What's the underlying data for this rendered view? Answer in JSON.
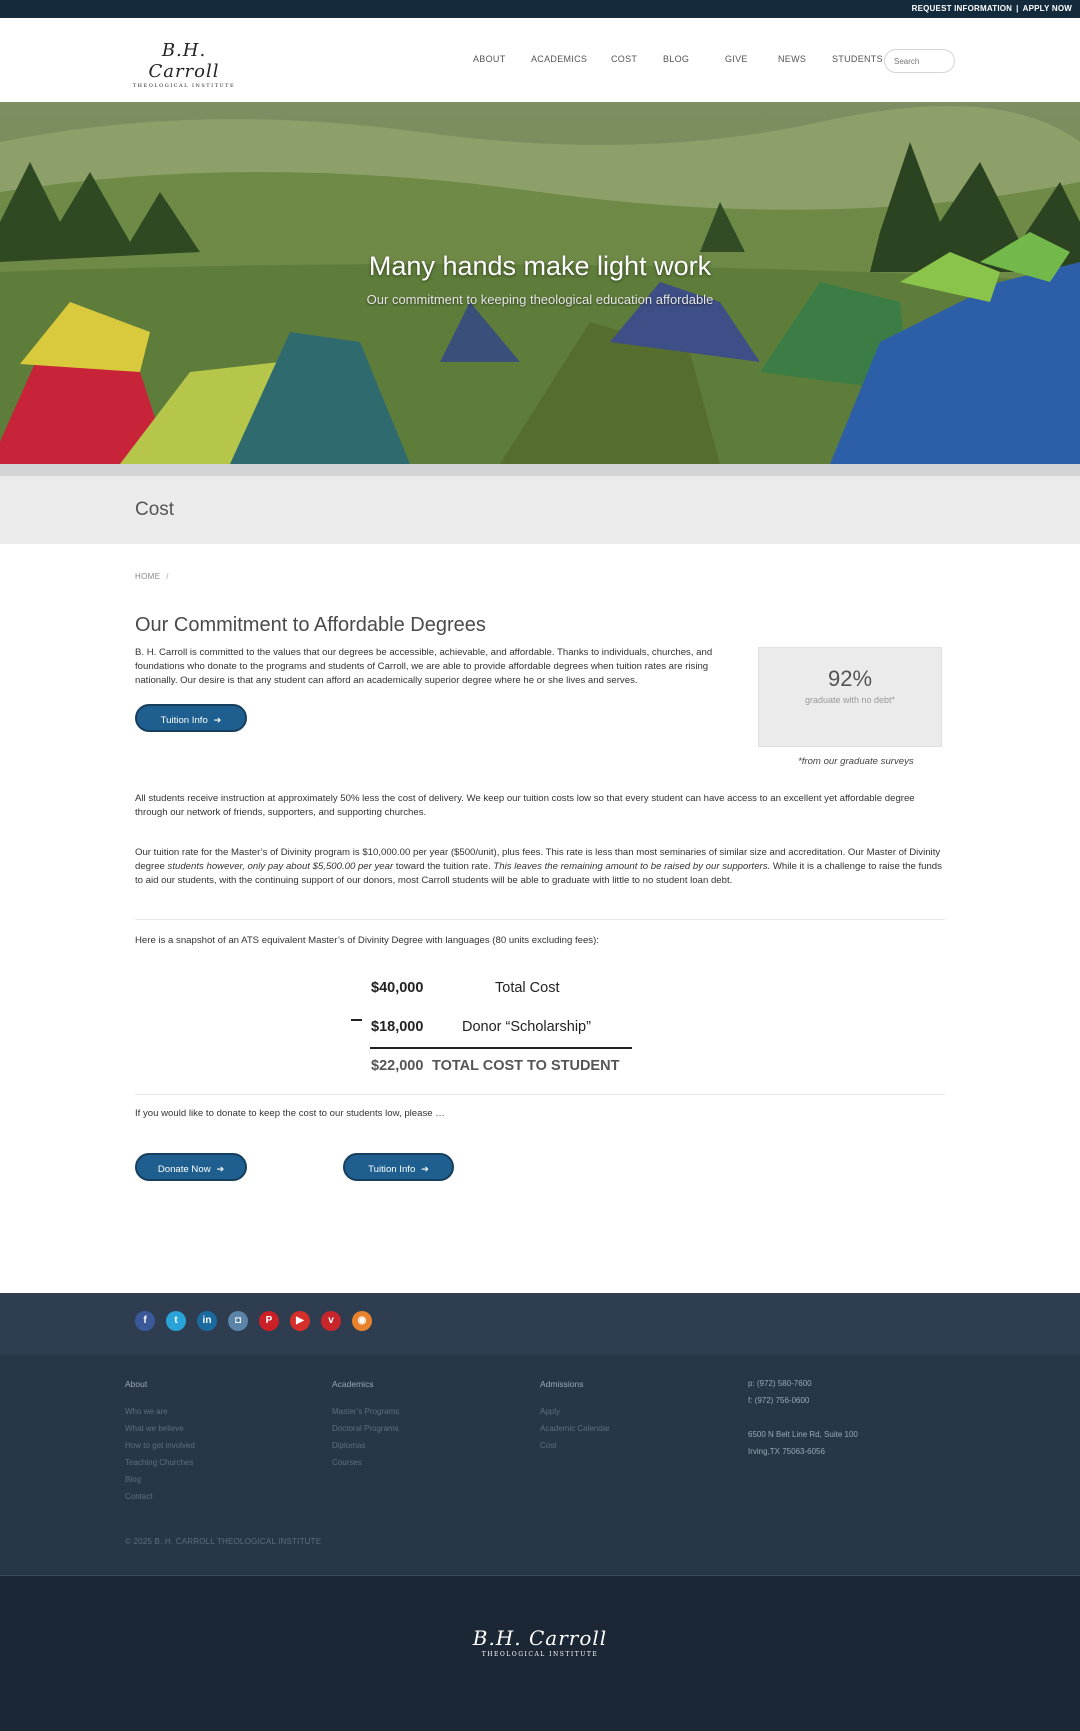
{
  "topbar": {
    "request_info": "REQUEST INFORMATION",
    "separator": "|",
    "apply_now": "APPLY NOW"
  },
  "header": {
    "logo_script": "B.H. Carroll",
    "logo_sub": "THEOLOGICAL INSTITUTE",
    "nav": [
      "ABOUT",
      "ACADEMICS",
      "COST",
      "BLOG",
      "GIVE",
      "NEWS",
      "STUDENTS"
    ],
    "search_placeholder": "Search"
  },
  "hero": {
    "title": "Many hands make light work",
    "subtitle": "Our commitment to keeping theological education affordable"
  },
  "page": {
    "title": "Cost",
    "breadcrumb_home": "HOME",
    "breadcrumb_sep": "/"
  },
  "content": {
    "heading": "Our Commitment to Affordable Degrees",
    "intro": "B. H. Carroll is committed to the values that our degrees be accessible, achievable, and affordable. Thanks to individuals, churches, and foundations who donate to the programs and students of Carroll, we are able to provide affordable degrees when tuition rates are rising nationally. Our desire is that any student can afford an academically superior degree where he or she lives and serves.",
    "tuition_button": "Tuition Info",
    "stat": {
      "value": "92%",
      "label": "graduate with no debt*",
      "note": "*from our graduate surveys"
    },
    "para2": "All students receive instruction at approximately 50% less the cost of delivery. We keep our tuition costs low so that every student can have access to an excellent yet affordable degree through our network of friends, supporters, and supporting churches.",
    "para3_a": "Our tuition rate for the Master’s of Divinity program is $10,000.00 per year ($500/unit), plus fees. This rate is less than most seminaries of similar size and accreditation. Our Master of Divinity degree ",
    "para3_b": "students however, only pay about $5,500.00 per year",
    "para3_c": " toward the tuition rate. ",
    "para3_d": "This leaves the remaining amount to be raised by our supporters.",
    "para3_e": " While it is a challenge to raise the funds to aid our students, with the continuing support of our donors, most Carroll students will be able to graduate with little to no student loan debt.",
    "snapshot": "Here is a snapshot of an ATS equivalent Master’s of Divinity Degree with languages (80 units excluding fees):",
    "calc": {
      "total_amount": "$40,000",
      "total_label": "Total Cost",
      "scholarship_amount": "$18,000",
      "scholarship_label": "Donor “Scholarship”",
      "student_amount": "$22,000",
      "student_label": "TOTAL COST TO STUDENT"
    },
    "donate_text": "If you would like to donate to keep the cost to our students low, please …",
    "donate_button": "Donate Now",
    "tuition_button_2": "Tuition Info"
  },
  "footer": {
    "social": [
      {
        "icon": "facebook-icon",
        "glyph": "f",
        "color": "#3b5998"
      },
      {
        "icon": "twitter-icon",
        "glyph": "t",
        "color": "#2aa3d8"
      },
      {
        "icon": "linkedin-icon",
        "glyph": "in",
        "color": "#1a6aa0"
      },
      {
        "icon": "instagram-icon",
        "glyph": "◘",
        "color": "#5b84a8"
      },
      {
        "icon": "pinterest-icon",
        "glyph": "P",
        "color": "#cb2027"
      },
      {
        "icon": "youtube-icon",
        "glyph": "▶",
        "color": "#d62f2a"
      },
      {
        "icon": "vimeo-icon",
        "glyph": "v",
        "color": "#c8262b"
      },
      {
        "icon": "rss-icon",
        "glyph": "◉",
        "color": "#e9822c"
      }
    ],
    "columns": [
      {
        "title": "About",
        "links": [
          "Who we are",
          "What we believe",
          "How to get involved",
          "Teaching Churches",
          "Blog",
          "Contact"
        ]
      },
      {
        "title": "Academics",
        "links": [
          "Master’s Programs",
          "Doctoral Programs",
          "Diplomas",
          "Courses"
        ]
      },
      {
        "title": "Admissions",
        "links": [
          "Apply",
          "Academic Calendar",
          "Cost"
        ]
      }
    ],
    "contact": {
      "phone": "p: (972) 580-7600",
      "fax": "f: (972) 756-0600",
      "address1": "6500 N Belt Line Rd, Suite 100",
      "address2": "Irving,TX 75063-6056"
    },
    "copyright": "© 2025 B. H. CARROLL THEOLOGICAL INSTITUTE",
    "logo_script": "B.H. Carroll",
    "logo_sub": "THEOLOGICAL INSTITUTE"
  }
}
